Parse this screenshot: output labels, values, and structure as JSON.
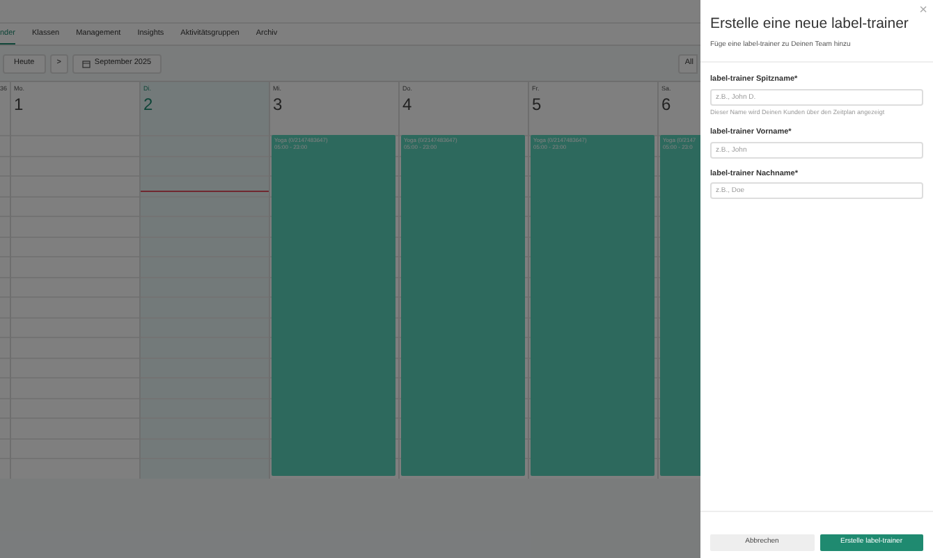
{
  "nav": {
    "tabs": [
      {
        "label": "nder",
        "selected": true
      },
      {
        "label": "Klassen",
        "selected": false
      },
      {
        "label": "Management",
        "selected": false
      },
      {
        "label": "Insights",
        "selected": false
      },
      {
        "label": "Aktivitätsgruppen",
        "selected": false
      },
      {
        "label": "Archiv",
        "selected": false
      }
    ]
  },
  "toolbar": {
    "today": "Heute",
    "next": ">",
    "month": "September 2025",
    "filter": "All"
  },
  "calendar": {
    "week": "36",
    "days": [
      {
        "weekday": "Mo.",
        "date": "1",
        "today": false
      },
      {
        "weekday": "Di.",
        "date": "2",
        "today": true
      },
      {
        "weekday": "Mi.",
        "date": "3",
        "today": false,
        "events": [
          {
            "title": "Yoga (0/2147483647)",
            "time": "05:00 - 23:00"
          }
        ]
      },
      {
        "weekday": "Do.",
        "date": "4",
        "today": false,
        "events": [
          {
            "title": "Yoga (0/2147483647)",
            "time": "05:00 - 23:00"
          }
        ]
      },
      {
        "weekday": "Fr.",
        "date": "5",
        "today": false,
        "events": [
          {
            "title": "Yoga (0/2147483647)",
            "time": "05:00 - 23:00"
          }
        ]
      },
      {
        "weekday": "Sa.",
        "date": "6",
        "today": false,
        "events": [
          {
            "title": "Yoga (0/2147",
            "time": "05:00 - 23:0"
          }
        ]
      }
    ]
  },
  "dialog": {
    "title": "Erstelle eine neue label-trainer",
    "subtitle": "Füge eine label-trainer zu Deinen Team hinzu",
    "close": "×",
    "fields": [
      {
        "label": "label-trainer Spitzname*",
        "placeholder": "z.B., John D.",
        "hint": "Dieser Name wird Deinen Kunden über den Zeitplan angezeigt"
      },
      {
        "label": "label-trainer Vorname*",
        "placeholder": "z.B., John"
      },
      {
        "label": "label-trainer Nachname*",
        "placeholder": "z.B., Doe"
      }
    ],
    "cancel": "Abbrechen",
    "submit": "Erstelle label-trainer"
  }
}
